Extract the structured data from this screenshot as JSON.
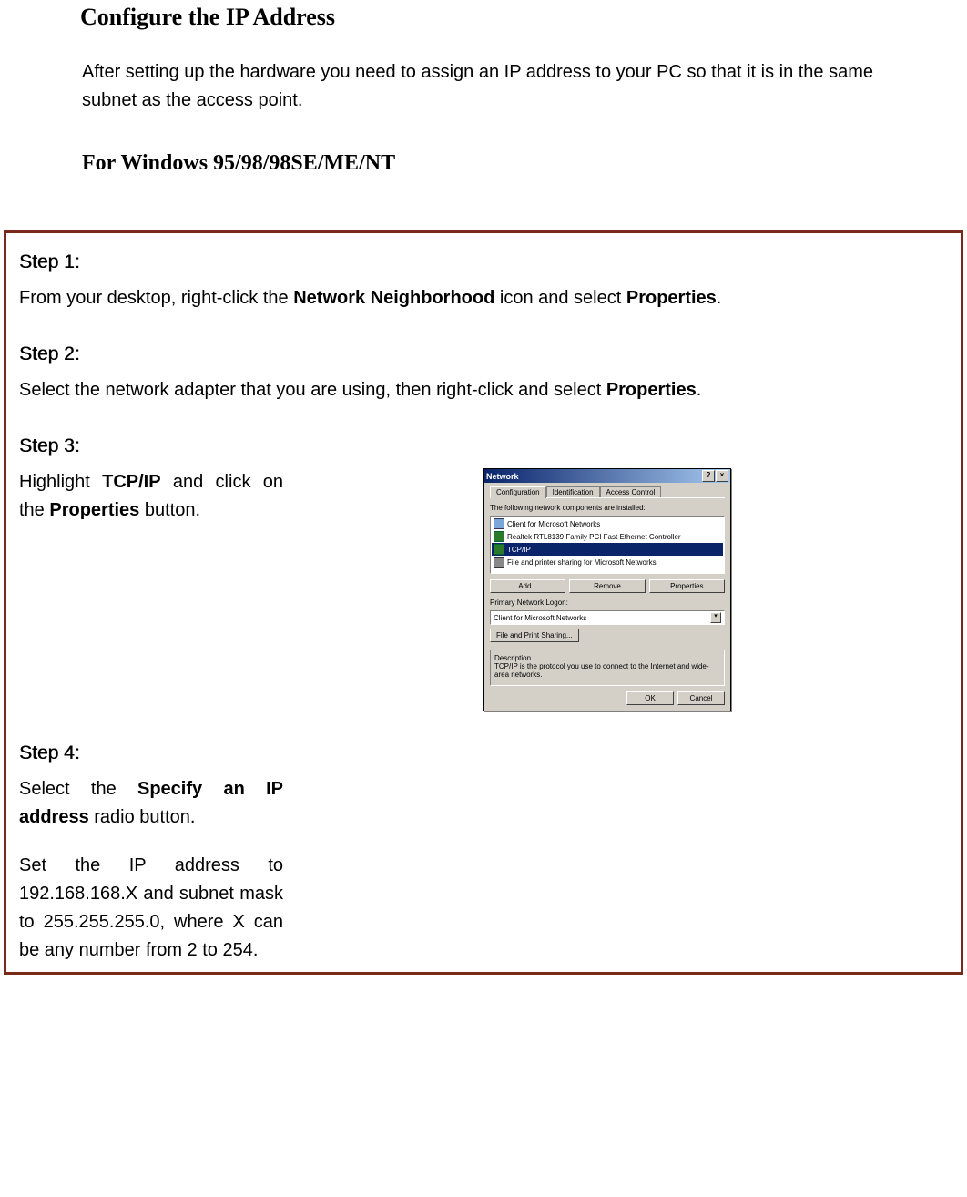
{
  "heading1": "Configure the IP Address",
  "intro": "After setting up the hardware you need to assign an IP address to your PC so that it is in the same subnet as the access point.",
  "heading2": "For Windows 95/98/98SE/ME/NT",
  "steps": {
    "s1": {
      "label": "Step 1:",
      "pre": "From your desktop, right-click the ",
      "bold1": "Network Neighborhood",
      "mid": " icon and select ",
      "bold2": "Properties",
      "post": "."
    },
    "s2": {
      "label": "Step 2:",
      "pre": "Select the network adapter that you are using, then right-click and select ",
      "bold1": "Properties",
      "post": "."
    },
    "s3": {
      "label": "Step 3:",
      "pre": "Highlight ",
      "bold1": "TCP/IP",
      "mid": " and click on the ",
      "bold2": "Properties",
      "post": " button."
    },
    "s4": {
      "label": "Step 4:",
      "p1_pre": "Select the ",
      "p1_bold": "Specify an IP address",
      "p1_post": " radio button.",
      "p2": "Set the IP address to 192.168.168.X and subnet mask to 255.255.255.0, where X can be any number from 2 to 254."
    }
  },
  "dialog": {
    "title": "Network",
    "help_btn": "?",
    "close_btn": "×",
    "tabs": [
      "Configuration",
      "Identification",
      "Access Control"
    ],
    "installed_label": "The following network components are installed:",
    "components": [
      "Client for Microsoft Networks",
      "Realtek RTL8139 Family PCI Fast Ethernet Controller",
      "TCP/IP",
      "File and printer sharing for Microsoft Networks"
    ],
    "buttons": {
      "add": "Add...",
      "remove": "Remove",
      "properties": "Properties"
    },
    "logon_label": "Primary Network Logon:",
    "logon_value": "Client for Microsoft Networks",
    "fps_button": "File and Print Sharing...",
    "desc_label": "Description",
    "desc_text": "TCP/IP is the protocol you use to connect to the Internet and wide-area networks.",
    "ok": "OK",
    "cancel": "Cancel"
  }
}
